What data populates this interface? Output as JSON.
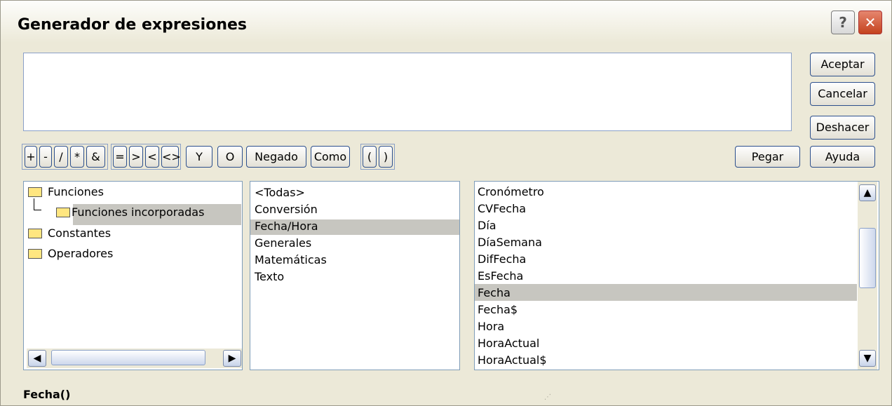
{
  "dialog": {
    "title": "Generador de expresiones",
    "help_button": "?",
    "close_button": "✕"
  },
  "expression": {
    "value": ""
  },
  "actions": {
    "aceptar": "Aceptar",
    "cancelar": "Cancelar",
    "deshacer": "Deshacer",
    "pegar": "Pegar",
    "ayuda": "Ayuda"
  },
  "operators": {
    "plus": "+",
    "minus": "-",
    "divide": "/",
    "multiply": "*",
    "concat": "&",
    "equal": "=",
    "greater": ">",
    "less": "<",
    "notequal": "<>",
    "and": "Y",
    "or": "O",
    "not": "Negado",
    "like": "Como",
    "open_paren": "(",
    "close_paren": ")"
  },
  "tree": {
    "items": [
      {
        "label": "Funciones"
      },
      {
        "label": "Funciones incorporadas",
        "selected": true
      },
      {
        "label": "Constantes"
      },
      {
        "label": "Operadores"
      }
    ]
  },
  "categories": {
    "items": [
      "<Todas>",
      "Conversión",
      "Fecha/Hora",
      "Generales",
      "Matemáticas",
      "Texto"
    ],
    "selected": "Fecha/Hora"
  },
  "functions": {
    "items": [
      "Cronómetro",
      "CVFecha",
      "Día",
      "DíaSemana",
      "DifFecha",
      "EsFecha",
      "Fecha",
      "Fecha$",
      "Hora",
      "HoraActual",
      "HoraActual$"
    ],
    "selected": "Fecha"
  },
  "status": {
    "syntax": "Fecha()"
  },
  "colors": {
    "selection": "#c7c6c0",
    "dialog_bg": "#ece9d8",
    "close": "#c4421e"
  }
}
